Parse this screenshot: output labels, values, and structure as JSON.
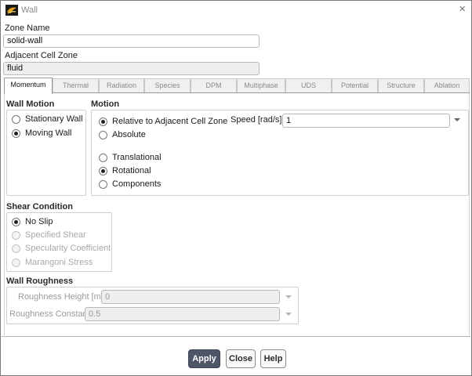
{
  "window": {
    "title": "Wall",
    "close_glyph": "×"
  },
  "zone_name": {
    "label": "Zone Name",
    "value": "solid-wall"
  },
  "adjacent_cell_zone": {
    "label": "Adjacent Cell Zone",
    "value": "fluid"
  },
  "tabs": [
    {
      "label": "Momentum",
      "active": true
    },
    {
      "label": "Thermal",
      "active": false
    },
    {
      "label": "Radiation",
      "active": false
    },
    {
      "label": "Species",
      "active": false
    },
    {
      "label": "DPM",
      "active": false
    },
    {
      "label": "Multiphase",
      "active": false
    },
    {
      "label": "UDS",
      "active": false
    },
    {
      "label": "Potential",
      "active": false
    },
    {
      "label": "Structure",
      "active": false
    },
    {
      "label": "Ablation",
      "active": false
    }
  ],
  "wall_motion": {
    "title": "Wall Motion",
    "options": [
      {
        "label": "Stationary Wall",
        "selected": false
      },
      {
        "label": "Moving Wall",
        "selected": true
      }
    ]
  },
  "motion": {
    "title": "Motion",
    "reference": [
      {
        "label": "Relative to Adjacent Cell Zone",
        "selected": true
      },
      {
        "label": "Absolute",
        "selected": false
      }
    ],
    "type": [
      {
        "label": "Translational",
        "selected": false
      },
      {
        "label": "Rotational",
        "selected": true
      },
      {
        "label": "Components",
        "selected": false
      }
    ],
    "speed": {
      "label": "Speed [rad/s]",
      "value": "1"
    }
  },
  "shear_condition": {
    "title": "Shear Condition",
    "options": [
      {
        "label": "No Slip",
        "selected": true,
        "enabled": true
      },
      {
        "label": "Specified Shear",
        "selected": false,
        "enabled": false
      },
      {
        "label": "Specularity Coefficient",
        "selected": false,
        "enabled": false
      },
      {
        "label": "Marangoni Stress",
        "selected": false,
        "enabled": false
      }
    ]
  },
  "wall_roughness": {
    "title": "Wall Roughness",
    "height": {
      "label": "Roughness Height [m]",
      "value": "0"
    },
    "constant": {
      "label": "Roughness Constant",
      "value": "0.5"
    }
  },
  "buttons": {
    "apply": "Apply",
    "close": "Close",
    "help": "Help"
  },
  "colors": {
    "primary_button": "#4d5566",
    "app_icon": "#e8a51c"
  },
  "icons": {
    "app": "fluent-app-icon",
    "close": "close-icon",
    "dropdown": "chevron-down-icon"
  }
}
